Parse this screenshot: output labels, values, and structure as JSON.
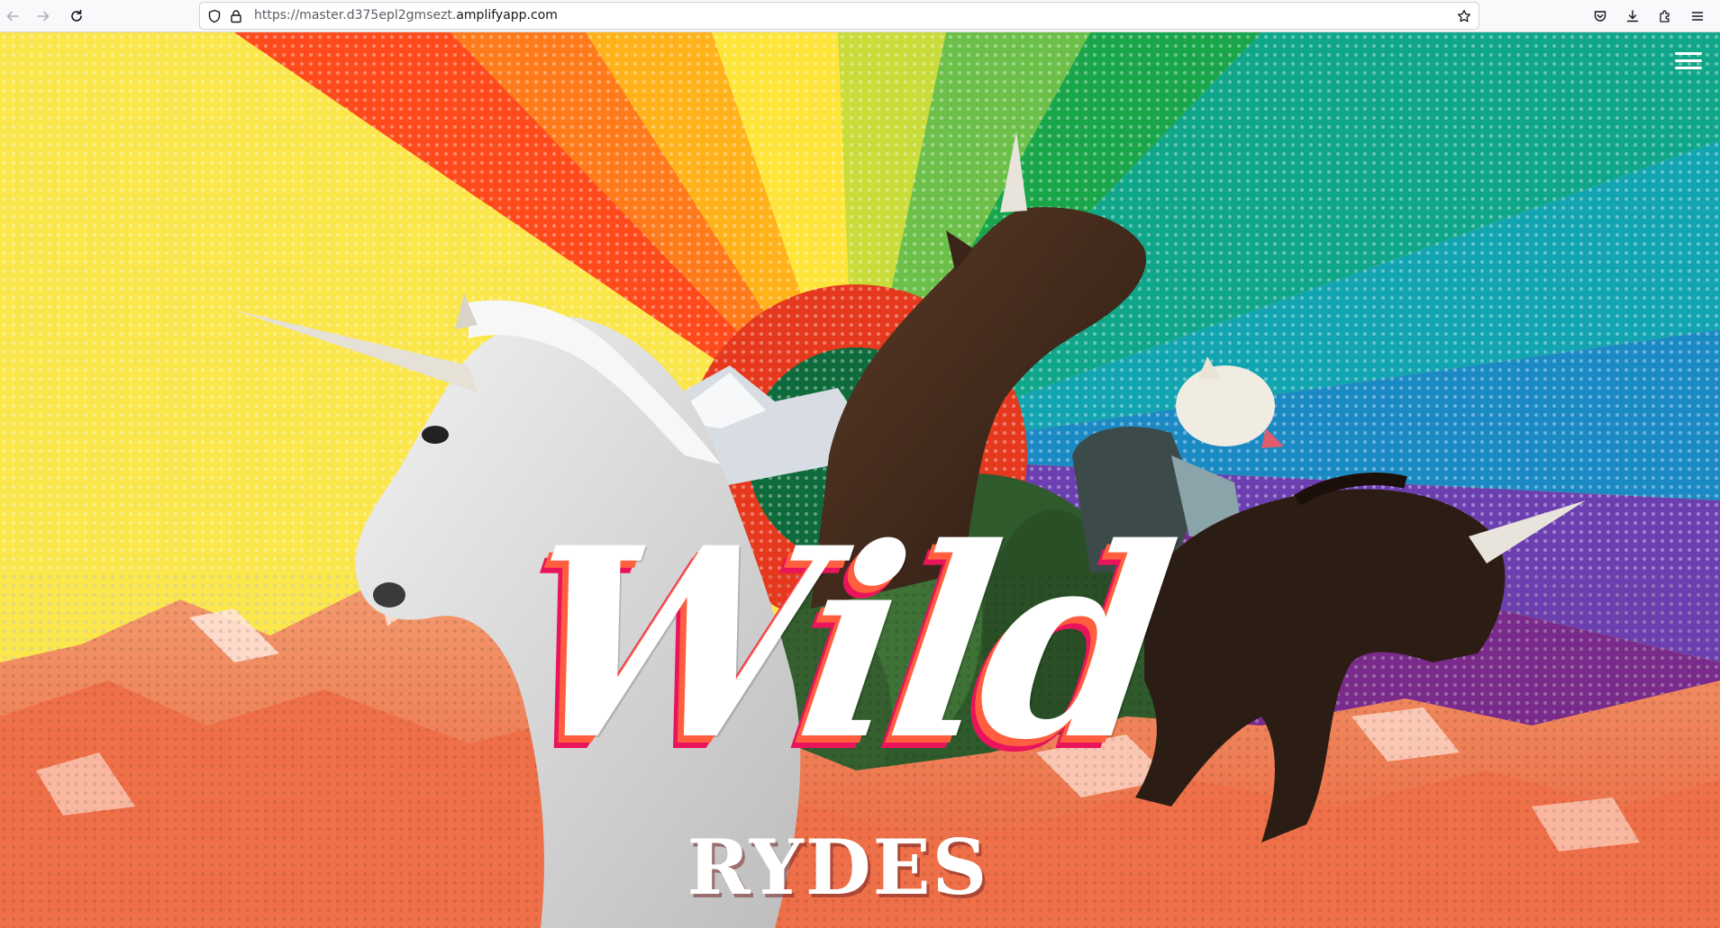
{
  "browser": {
    "url_prefix": "https://master.d375epl2gmsezt.",
    "url_host": "amplifyapp.com",
    "icons": {
      "back": "back-arrow-icon",
      "forward": "forward-arrow-icon",
      "reload": "reload-icon",
      "tracking": "shield-icon",
      "lock": "lock-icon",
      "bookmark": "star-icon",
      "pocket": "pocket-icon",
      "downloads": "download-icon",
      "extensions": "puzzle-icon",
      "menu": "hamburger-menu-icon"
    }
  },
  "page": {
    "title_script": "Wild",
    "title_caps": "RYDES",
    "menu_icon": "hamburger-menu-icon",
    "colors": {
      "rainbow": [
        "#ff4a1c",
        "#ff7a1a",
        "#ffb21a",
        "#ffe43a",
        "#c9dc3a",
        "#6cc04a",
        "#19a64a",
        "#10a68a",
        "#1aa3c8",
        "#6b3fb0",
        "#7a2a8a"
      ],
      "accent_pink": "#e9145c",
      "accent_orange": "#ff5f3f",
      "mountain": "#f27a55"
    }
  }
}
